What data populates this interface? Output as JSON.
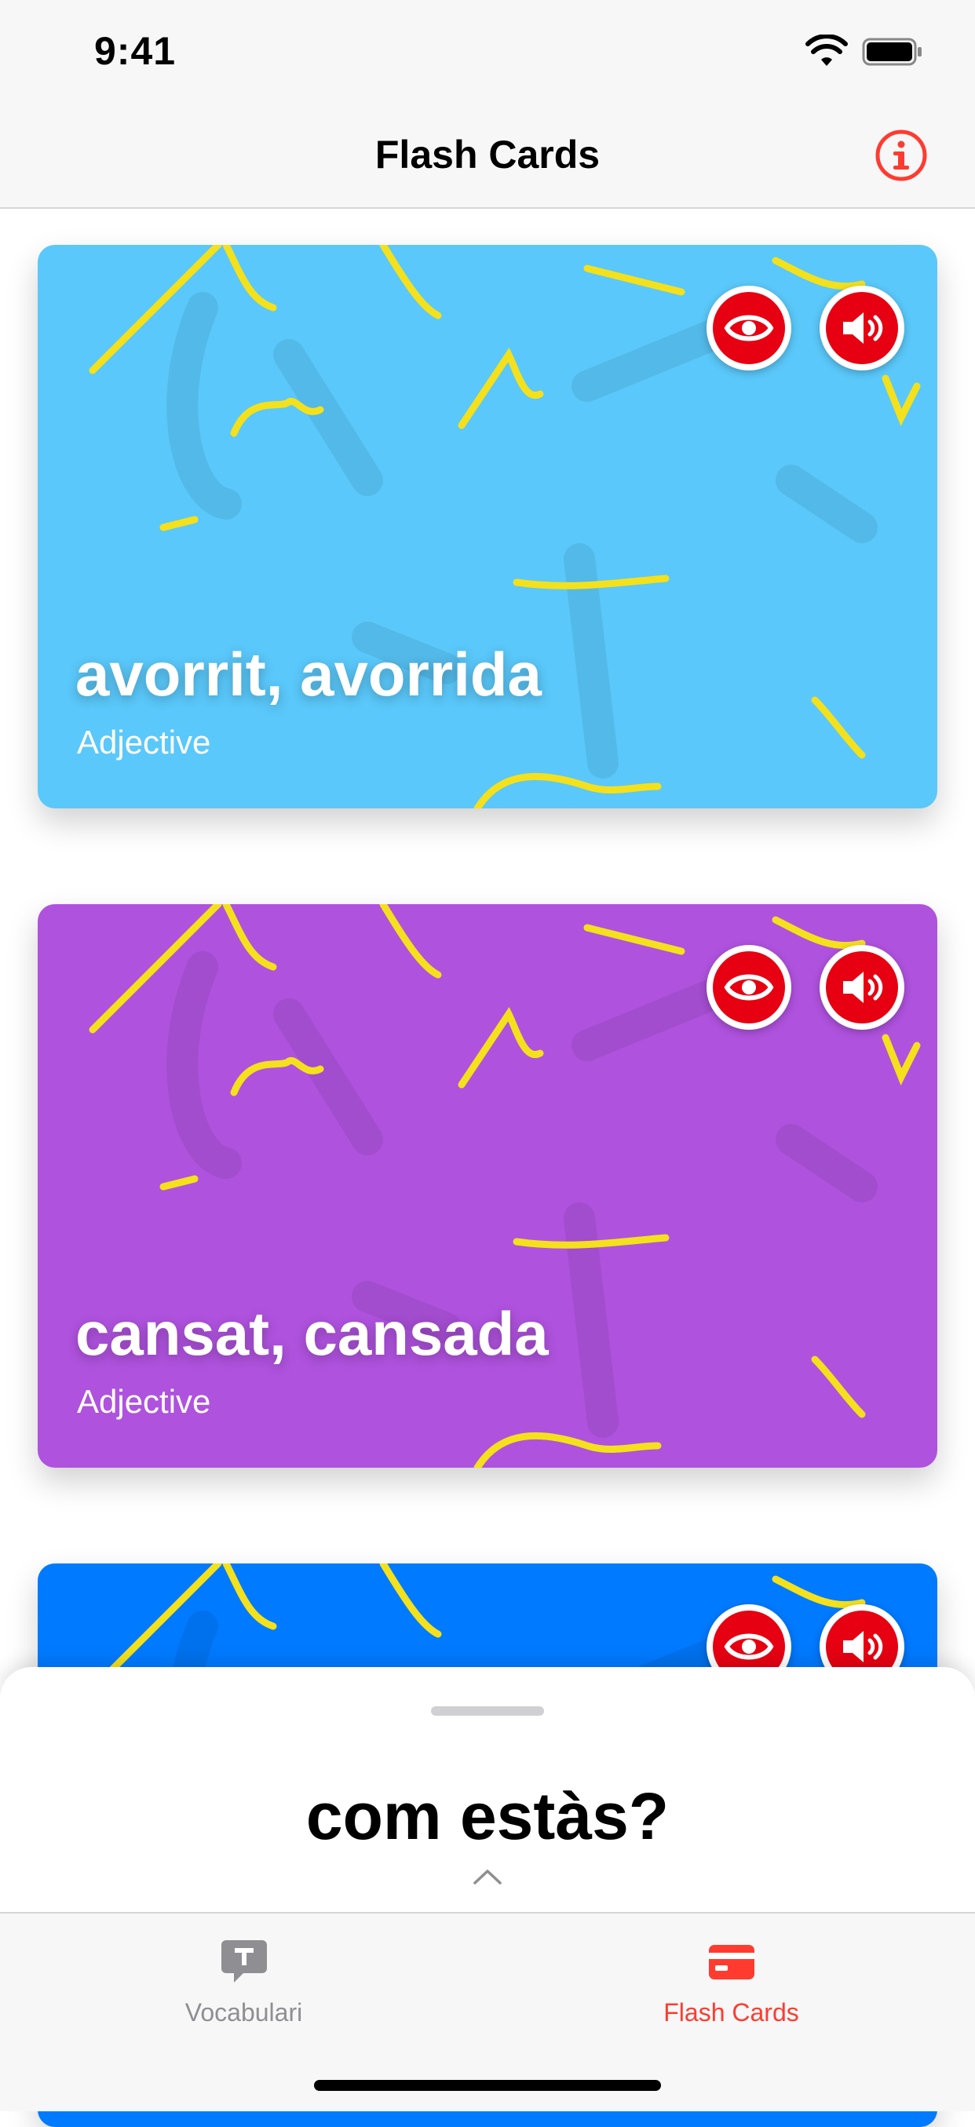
{
  "status_bar": {
    "time": "9:41"
  },
  "nav": {
    "title": "Flash Cards",
    "info_icon": "info-circle-icon"
  },
  "colors": {
    "accent": "#ff3b30",
    "card1": "#5ac8fa",
    "card2": "#af52de",
    "card3": "#007aff",
    "scribble": "#f4e11b"
  },
  "cards": [
    {
      "word": "avorrit, avorrida",
      "type": "Adjective",
      "color": "#5ac8fa"
    },
    {
      "word": "cansat, cansada",
      "type": "Adjective",
      "color": "#af52de"
    },
    {
      "word": "",
      "type": "",
      "color": "#007aff"
    }
  ],
  "sheet": {
    "phrase": "com estàs?"
  },
  "tabs": [
    {
      "label": "Vocabulari",
      "icon": "text-bubble-icon",
      "active": false
    },
    {
      "label": "Flash Cards",
      "icon": "card-icon",
      "active": true
    }
  ]
}
